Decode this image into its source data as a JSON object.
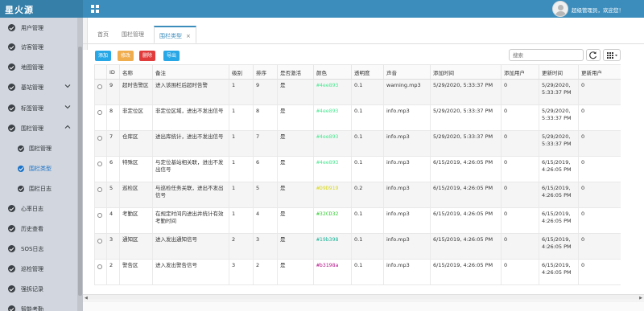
{
  "app": {
    "brand": "星火源"
  },
  "header": {
    "welcome": "超级管理员，欢迎您！"
  },
  "sidebar": {
    "items": [
      {
        "label": "用户管理",
        "chevron": ""
      },
      {
        "label": "访客管理",
        "chevron": ""
      },
      {
        "label": "地图管理",
        "chevron": ""
      },
      {
        "label": "基站管理",
        "chevron": "down"
      },
      {
        "label": "标签管理",
        "chevron": "down"
      },
      {
        "label": "围栏管理",
        "chevron": "up"
      },
      {
        "label": "围栏管理",
        "sub": true
      },
      {
        "label": "围栏类型",
        "sub": true,
        "active": true
      },
      {
        "label": "围栏日志",
        "sub": true
      },
      {
        "label": "心率日志",
        "chevron": ""
      },
      {
        "label": "历史查看",
        "chevron": ""
      },
      {
        "label": "SOS日志",
        "chevron": ""
      },
      {
        "label": "巡检管理",
        "chevron": ""
      },
      {
        "label": "强拆记录",
        "chevron": ""
      },
      {
        "label": "智能考勤",
        "chevron": ""
      }
    ]
  },
  "tabs": [
    {
      "label": "首页"
    },
    {
      "label": "围栏管理"
    },
    {
      "label": "围栏类型",
      "active": true,
      "close": "×"
    }
  ],
  "toolbar": {
    "add": "添加",
    "edit": "修改",
    "delete": "删除",
    "export": "导出",
    "search_placeholder": "搜索"
  },
  "table": {
    "columns": [
      "",
      "ID",
      "名称",
      "备注",
      "级别",
      "排序",
      "是否激活",
      "颜色",
      "透明度",
      "声音",
      "添加时间",
      "添加用户",
      "更新时间",
      "更新用户"
    ],
    "rows": [
      [
        "9",
        "超时告警区",
        "进入该围栏后超时告警",
        "1",
        "9",
        "是",
        "#4ee893",
        "0.1",
        "warning.mp3",
        "5/29/2020, 5:33:37 PM",
        "0",
        "5/29/2020, 5:33:37 PM",
        "0"
      ],
      [
        "8",
        "非定位区",
        "非定位区域，进出不发出信号",
        "1",
        "8",
        "是",
        "#4ee893",
        "0.1",
        "info.mp3",
        "5/29/2020, 5:33:37 PM",
        "0",
        "5/29/2020, 5:33:37 PM",
        "0"
      ],
      [
        "7",
        "仓库区",
        "进出库统计，进出不发出信号",
        "1",
        "7",
        "是",
        "#4ee893",
        "0.1",
        "info.mp3",
        "5/29/2020, 5:33:37 PM",
        "0",
        "5/29/2020, 5:33:37 PM",
        "0"
      ],
      [
        "6",
        "特殊区",
        "与定位基站相关联，进出不发出信号",
        "1",
        "6",
        "是",
        "#4ee893",
        "0.1",
        "info.mp3",
        "6/15/2019, 4:26:05 PM",
        "0",
        "6/15/2019, 4:26:05 PM",
        "0"
      ],
      [
        "5",
        "巡检区",
        "与巡检任务关联，进出不发出信号",
        "1",
        "5",
        "是",
        "#D9D919",
        "0.2",
        "info.mp3",
        "6/15/2019, 4:26:05 PM",
        "0",
        "6/15/2019, 4:26:05 PM",
        "0"
      ],
      [
        "4",
        "考勤区",
        "在规定时间内进出并统计有效考勤时间",
        "1",
        "4",
        "是",
        "#32CD32",
        "0.1",
        "info.mp3",
        "6/15/2019, 4:26:05 PM",
        "0",
        "6/15/2019, 4:26:05 PM",
        "0"
      ],
      [
        "3",
        "通知区",
        "进入发出通知信号",
        "2",
        "3",
        "是",
        "#19b398",
        "0.1",
        "info.mp3",
        "6/15/2019, 4:26:05 PM",
        "0",
        "6/15/2019, 4:26:05 PM",
        "0"
      ],
      [
        "2",
        "警告区",
        "进入发出警告信号",
        "3",
        "2",
        "是",
        "#b3198a",
        "0.1",
        "info.mp3",
        "6/15/2019, 4:26:05 PM",
        "0",
        "6/15/2019, 4:26:05 PM",
        "0"
      ]
    ]
  },
  "colors": {
    "topbar": "#3c8dbc",
    "brand_bg": "#367fa9",
    "sidebar_bg": "#d2d6de",
    "active": "#1a73c8"
  }
}
